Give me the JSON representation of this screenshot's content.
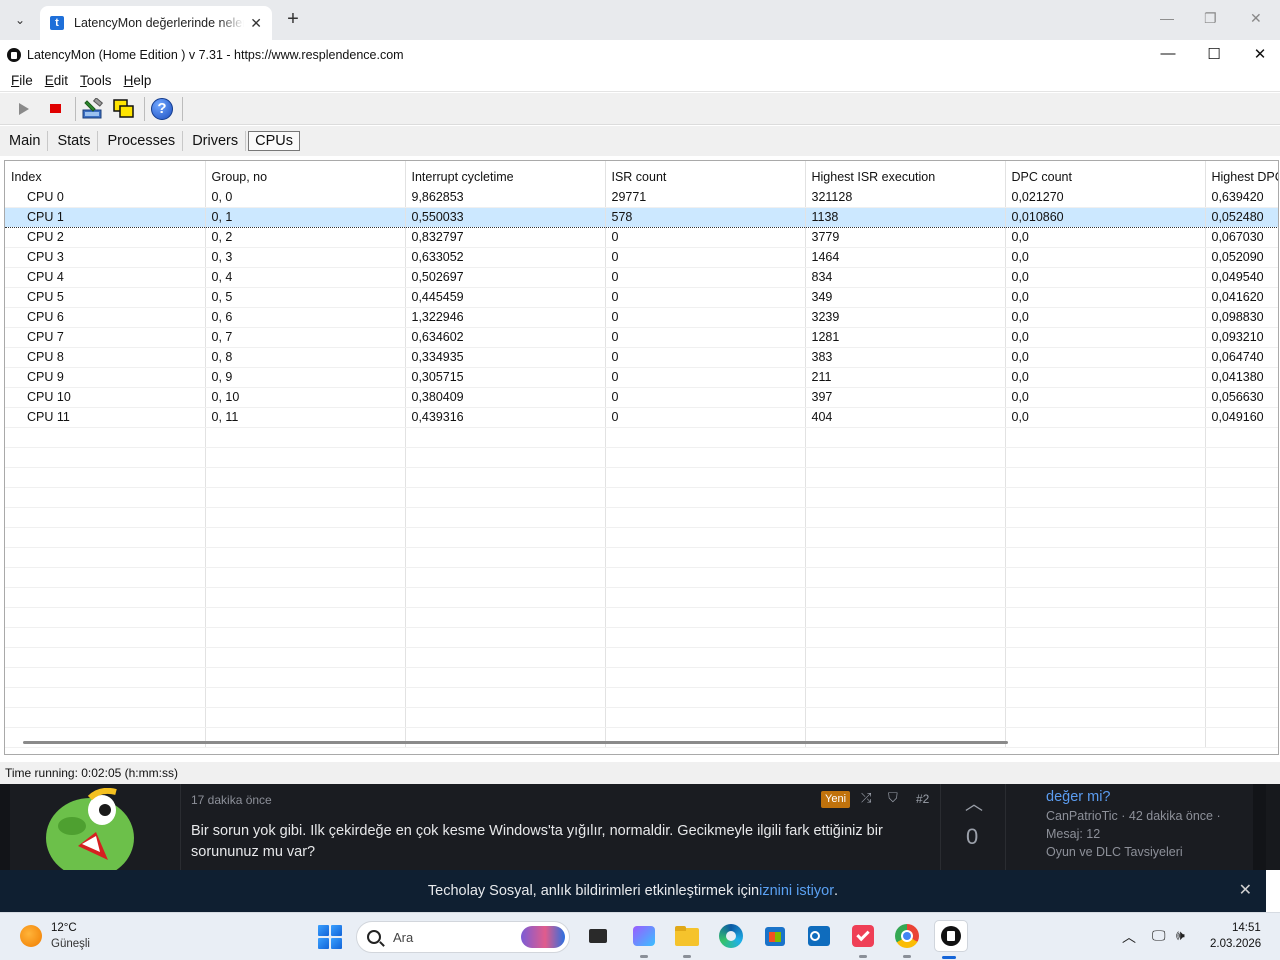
{
  "browser": {
    "tab_title": "LatencyMon değerlerinde nelere",
    "tab_favicon": "t",
    "new_tab": "+",
    "dropdown": "⌄",
    "tab_close": "✕",
    "minimize": "—",
    "restore": "❐",
    "close": "✕"
  },
  "app": {
    "title": "LatencyMon  (Home Edition )  v 7.31 - https://www.resplendence.com",
    "minimize": "—",
    "maximize": "☐",
    "close": "✕"
  },
  "menu": [
    {
      "label": "File"
    },
    {
      "label": "Edit"
    },
    {
      "label": "Tools"
    },
    {
      "label": "Help"
    }
  ],
  "toolbar": {
    "help_label": "?"
  },
  "tabs": [
    {
      "label": "Main",
      "active": false
    },
    {
      "label": "Stats",
      "active": false
    },
    {
      "label": "Processes",
      "active": false
    },
    {
      "label": "Drivers",
      "active": false
    },
    {
      "label": "CPUs",
      "active": true
    }
  ],
  "table": {
    "columns": [
      "Index",
      "Group, no",
      "Interrupt cycletime",
      "ISR count",
      "Highest ISR execution",
      "DPC count",
      "Highest DPC execution"
    ],
    "rows": [
      [
        "CPU 0",
        "0, 0",
        "9,862853",
        "29771",
        "321128",
        "0,021270",
        "0,639420"
      ],
      [
        "CPU 1",
        "0, 1",
        "0,550033",
        "578",
        "1138",
        "0,010860",
        "0,052480"
      ],
      [
        "CPU 2",
        "0, 2",
        "0,832797",
        "0",
        "3779",
        "0,0",
        "0,067030"
      ],
      [
        "CPU 3",
        "0, 3",
        "0,633052",
        "0",
        "1464",
        "0,0",
        "0,052090"
      ],
      [
        "CPU 4",
        "0, 4",
        "0,502697",
        "0",
        "834",
        "0,0",
        "0,049540"
      ],
      [
        "CPU 5",
        "0, 5",
        "0,445459",
        "0",
        "349",
        "0,0",
        "0,041620"
      ],
      [
        "CPU 6",
        "0, 6",
        "1,322946",
        "0",
        "3239",
        "0,0",
        "0,098830"
      ],
      [
        "CPU 7",
        "0, 7",
        "0,634602",
        "0",
        "1281",
        "0,0",
        "0,093210"
      ],
      [
        "CPU 8",
        "0, 8",
        "0,334935",
        "0",
        "383",
        "0,0",
        "0,064740"
      ],
      [
        "CPU 9",
        "0, 9",
        "0,305715",
        "0",
        "211",
        "0,0",
        "0,041380"
      ],
      [
        "CPU 10",
        "0, 10",
        "0,380409",
        "0",
        "397",
        "0,0",
        "0,056630"
      ],
      [
        "CPU 11",
        "0, 11",
        "0,439316",
        "0",
        "404",
        "0,0",
        "0,049160"
      ]
    ],
    "selected_row": 1
  },
  "status": {
    "text": "Time running: 0:02:05  (h:mm:ss)"
  },
  "forum": {
    "post_time": "17 dakika önce",
    "badge": "Yeni",
    "post_number": "#2",
    "post_text": "Bir sorun yok gibi. Ilk çekirdeğe en çok kesme Windows'ta yığılır, normaldir. Gecikmeyle ilgili fark ettiğiniz bir sorununuz mu var?",
    "vote_count": "0",
    "side_title": "değer mi?",
    "side_meta_1": "CanPatrioTic · 42 dakika önce ·",
    "side_meta_2": "Mesaj: 12",
    "side_meta_3": "Oyun ve DLC Tavsiyeleri"
  },
  "notification": {
    "text_before": "Techolay Sosyal, anlık bildirimleri etkinleştirmek için ",
    "link": "iznini istiyor",
    "text_after": ".",
    "close": "✕"
  },
  "taskbar": {
    "weather_temp": "12°C",
    "weather_desc": "Güneşli",
    "search_placeholder": "Ara",
    "time": "14:51",
    "date": "2.03.2026",
    "tray_chevron": "︿"
  },
  "colors": {
    "selection": "#cce8ff",
    "stop_red": "#e00000",
    "notif_bg": "#0f1f31",
    "link_blue": "#5aa0f2"
  }
}
